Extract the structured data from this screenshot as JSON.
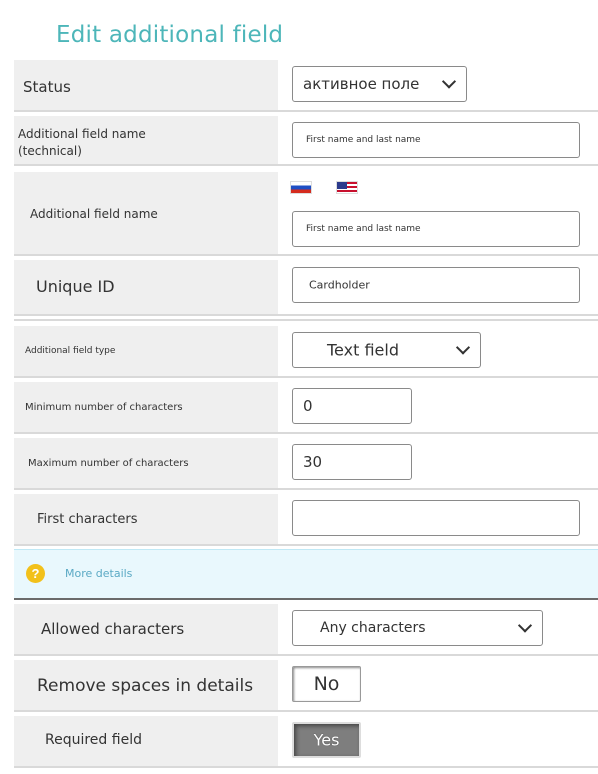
{
  "page": {
    "title": "Edit additional field"
  },
  "fields": {
    "status": {
      "label": "Status",
      "value": "активное поле"
    },
    "technical_name": {
      "label_line1": "Additional field name",
      "label_line2": "(technical)",
      "value": "First name and last name"
    },
    "display_name": {
      "label": "Additional field name",
      "value": "First name and last name",
      "languages": [
        "ru",
        "us"
      ]
    },
    "unique_id": {
      "label": "Unique ID",
      "value": "Cardholder"
    },
    "field_type": {
      "label": "Additional field type",
      "value": "Text field"
    },
    "min_chars": {
      "label": "Minimum number of characters",
      "value": "0"
    },
    "max_chars": {
      "label": "Maximum number of characters",
      "value": "30"
    },
    "first_chars": {
      "label": "First characters",
      "value": ""
    },
    "more_details": {
      "label": "More details",
      "icon": "question-icon"
    },
    "allowed_chars": {
      "label": "Allowed characters",
      "value": "Any characters"
    },
    "remove_spaces": {
      "label": "Remove spaces in details",
      "value": "No"
    },
    "required": {
      "label": "Required field",
      "value": "Yes"
    }
  },
  "colors": {
    "title": "#4db6b9",
    "label_bg": "#efefef",
    "info_bg": "#e9f8fd",
    "help_icon": "#f2c11b",
    "link": "#5aa9c4"
  }
}
